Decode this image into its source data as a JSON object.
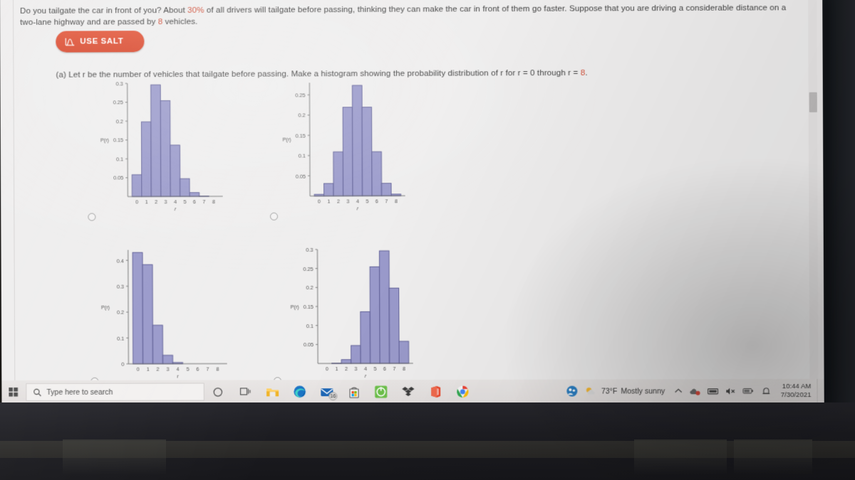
{
  "question": {
    "body": "Do you tailgate the car in front of you? About 30% of all drivers will tailgate before passing, thinking they can make the car in front of them go faster. Suppose that you are driving a considerable distance on a two-lane highway and are passed by 8 vehicles.",
    "highlight_percent": "30%",
    "highlight_n": "8",
    "part_a": "(a) Let r be the number of vehicles that tailgate before passing. Make a histogram showing the probability distribution of r for r = 0 through r = 8.",
    "salt_button_label": "USE SALT",
    "accent_color": "#d8482d",
    "highlight_color": "#d0503a"
  },
  "answer_options": [
    {
      "id": "option-a",
      "selected": false
    },
    {
      "id": "option-b",
      "selected": false
    },
    {
      "id": "option-c",
      "selected": false
    },
    {
      "id": "option-d",
      "selected": false
    }
  ],
  "chart_style": {
    "bar_fill": "#9a9acb",
    "bar_stroke": "#5b5b93",
    "axis_color": "#6a6a6a",
    "tick_text_color": "#555555"
  },
  "chart_data": [
    {
      "type": "bar",
      "title": "",
      "xlabel": "r",
      "ylabel": "P(r)",
      "categories": [
        "0",
        "1",
        "2",
        "3",
        "4",
        "5",
        "6",
        "7",
        "8"
      ],
      "values": [
        0.058,
        0.198,
        0.296,
        0.254,
        0.136,
        0.047,
        0.01,
        0.001,
        0.0
      ],
      "ylim": [
        0,
        0.3
      ],
      "yticks": [
        0.05,
        0.1,
        0.15,
        0.2,
        0.25,
        0.3
      ],
      "ytick_labels": [
        "0.05",
        "0.1",
        "0.15",
        "0.2",
        "0.25",
        "0.3"
      ],
      "grid": false,
      "legend": "none"
    },
    {
      "type": "bar",
      "title": "",
      "xlabel": "r",
      "ylabel": "P(r)",
      "categories": [
        "0",
        "1",
        "2",
        "3",
        "4",
        "5",
        "6",
        "7",
        "8"
      ],
      "values": [
        0.004,
        0.031,
        0.109,
        0.219,
        0.273,
        0.219,
        0.109,
        0.031,
        0.004
      ],
      "ylim": [
        0,
        0.28
      ],
      "yticks": [
        0.05,
        0.1,
        0.15,
        0.2,
        0.25
      ],
      "ytick_labels": [
        "0.05",
        "0.1",
        "0.15",
        "0.2",
        "0.25"
      ],
      "grid": false,
      "legend": "none"
    },
    {
      "type": "bar",
      "title": "",
      "xlabel": "r",
      "ylabel": "P(r)",
      "categories": [
        "0",
        "1",
        "2",
        "3",
        "4",
        "5",
        "6",
        "7",
        "8"
      ],
      "values": [
        0.43,
        0.383,
        0.149,
        0.033,
        0.005,
        0.0,
        0.0,
        0.0,
        0.0
      ],
      "ylim": [
        0,
        0.44
      ],
      "yticks": [
        0,
        0.1,
        0.2,
        0.3,
        0.4
      ],
      "ytick_labels": [
        "0",
        "0.1",
        "0.2",
        "0.3",
        "0.4"
      ],
      "grid": false,
      "legend": "none"
    },
    {
      "type": "bar",
      "title": "",
      "xlabel": "r",
      "ylabel": "P(r)",
      "categories": [
        "0",
        "1",
        "2",
        "3",
        "4",
        "5",
        "6",
        "7",
        "8"
      ],
      "values": [
        0.0,
        0.001,
        0.01,
        0.047,
        0.136,
        0.254,
        0.296,
        0.198,
        0.058
      ],
      "ylim": [
        0,
        0.3
      ],
      "yticks": [
        0.05,
        0.1,
        0.15,
        0.2,
        0.25,
        0.3
      ],
      "ytick_labels": [
        "0.05",
        "0.1",
        "0.15",
        "0.2",
        "0.25",
        "0.3"
      ],
      "grid": false,
      "legend": "none"
    }
  ],
  "taskbar": {
    "start_label": "start-button",
    "search_placeholder": "Type here to search",
    "apps": [
      {
        "name": "file-explorer-icon",
        "badge": ""
      },
      {
        "name": "microsoft-edge-icon",
        "badge": ""
      },
      {
        "name": "mail-icon",
        "badge": "16"
      },
      {
        "name": "microsoft-store-icon",
        "badge": ""
      },
      {
        "name": "green-app-icon",
        "badge": ""
      },
      {
        "name": "dropbox-icon",
        "badge": ""
      },
      {
        "name": "office-icon",
        "badge": ""
      },
      {
        "name": "google-chrome-icon",
        "badge": ""
      }
    ],
    "weather": {
      "temperature": "73°F",
      "condition": "Mostly sunny"
    },
    "clock": {
      "time": "10:44 AM",
      "date": "7/30/2021"
    }
  }
}
